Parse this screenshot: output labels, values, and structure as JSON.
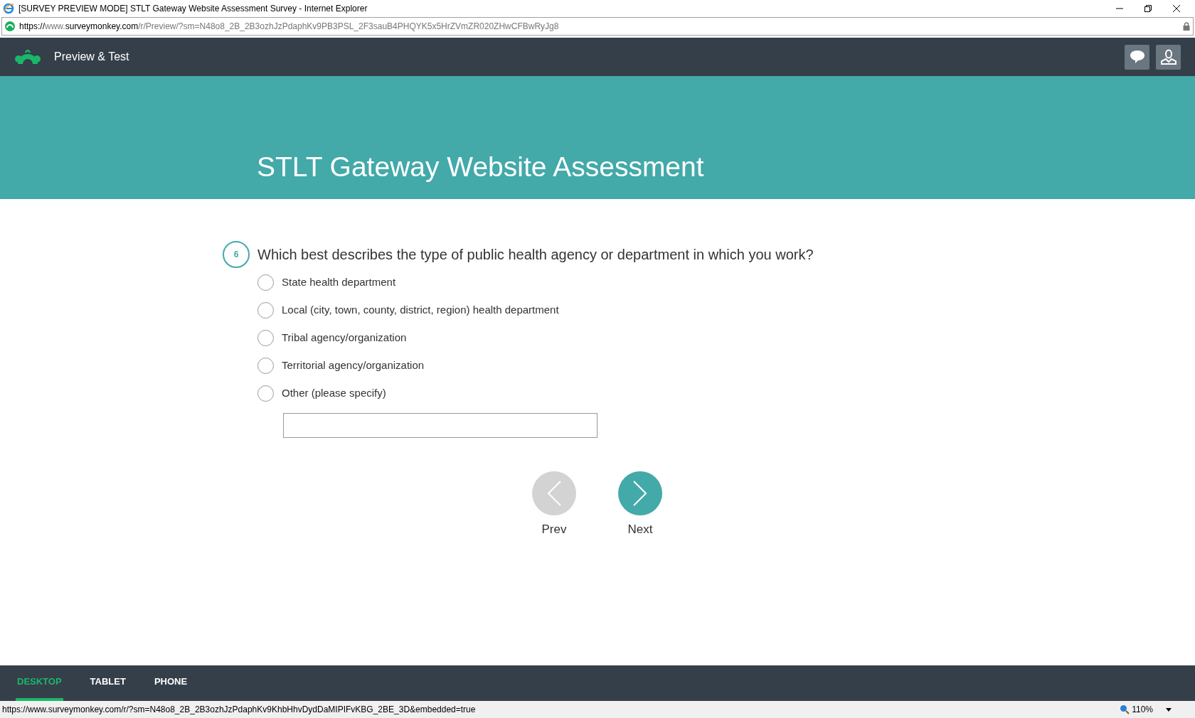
{
  "window": {
    "title": "[SURVEY PREVIEW MODE] STLT Gateway Website Assessment Survey - Internet Explorer"
  },
  "address_bar": {
    "scheme": "https://",
    "subdomain": "www.",
    "domain": "surveymonkey.com",
    "path": "/r/Preview/?sm=N48o8_2B_2B3ozhJzPdaphKv9PB3PSL_2F3sauB4PHQYK5x5HrZVmZR020ZHwCFBwRyJg8"
  },
  "header": {
    "title": "Preview & Test"
  },
  "survey": {
    "title": "STLT Gateway Website Assessment"
  },
  "question": {
    "number": "6",
    "text": "Which best describes the type of public health agency or department in which you work?",
    "options": [
      {
        "label": "State health department",
        "selected": false
      },
      {
        "label": "Local (city, town, county, district, region) health department",
        "selected": false
      },
      {
        "label": "Tribal agency/organization",
        "selected": false
      },
      {
        "label": "Territorial agency/organization",
        "selected": false
      },
      {
        "label": "Other (please specify)",
        "selected": false
      }
    ]
  },
  "navigation": [
    {
      "label": "Prev",
      "disabled": true
    },
    {
      "label": "Next",
      "disabled": false
    }
  ],
  "device_tabs": [
    {
      "label": "DESKTOP",
      "selected": true
    },
    {
      "label": "TABLET",
      "selected": false
    },
    {
      "label": "PHONE",
      "selected": false
    }
  ],
  "status_bar": {
    "url": "https://www.surveymonkey.com/r/?sm=N48o8_2B_2B3ozhJzPdaphKv9KhbHhvDydDaMIPIFvKBG_2BE_3D&embedded=true",
    "zoom": "110%"
  }
}
